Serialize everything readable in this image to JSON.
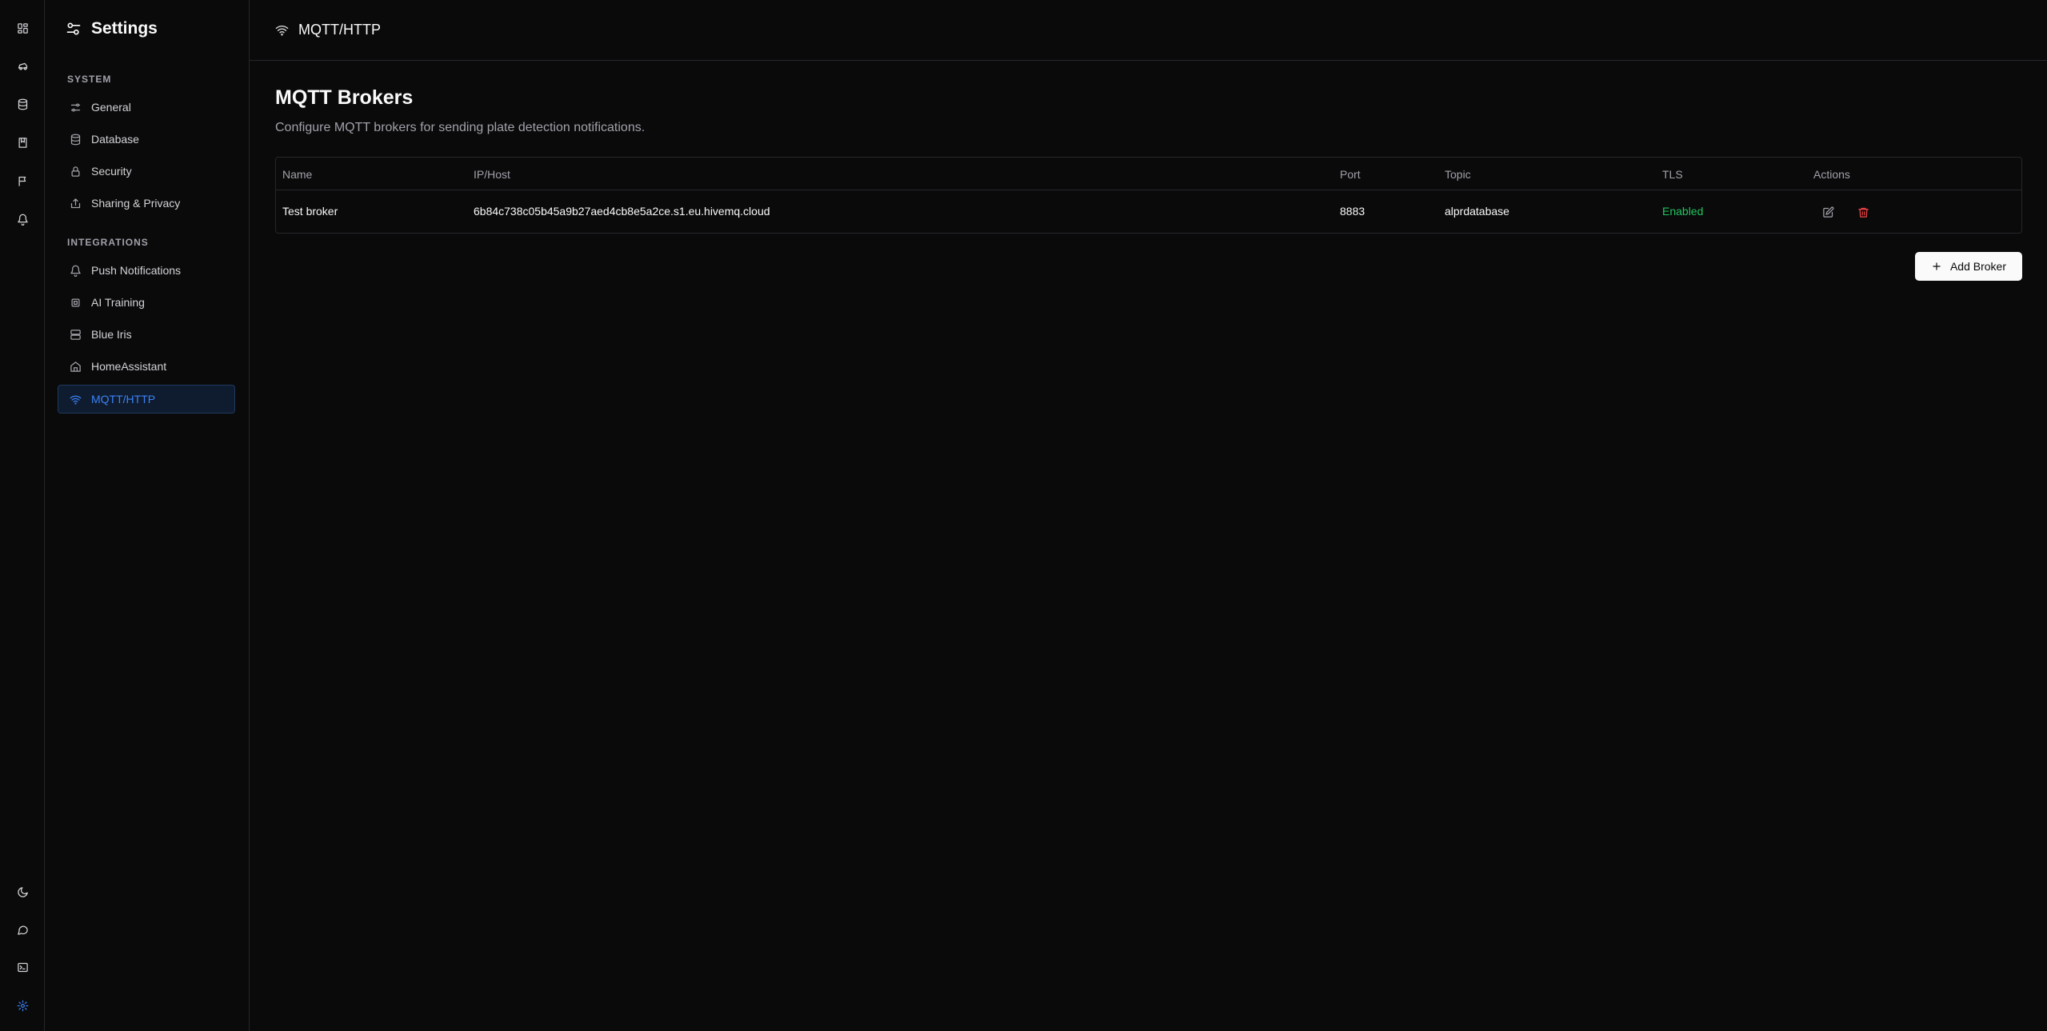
{
  "rail": {
    "top_icons": [
      "dashboard-icon",
      "car-icon",
      "database-icon",
      "book-icon",
      "flag-icon",
      "bell-icon"
    ],
    "bottom_icons": [
      "moon-icon",
      "message-icon",
      "terminal-icon",
      "gear-icon"
    ]
  },
  "sidebar": {
    "title": "Settings",
    "sections": [
      {
        "label": "SYSTEM",
        "items": [
          {
            "label": "General",
            "icon": "sliders-icon"
          },
          {
            "label": "Database",
            "icon": "database-icon"
          },
          {
            "label": "Security",
            "icon": "lock-icon"
          },
          {
            "label": "Sharing & Privacy",
            "icon": "share-icon"
          }
        ]
      },
      {
        "label": "INTEGRATIONS",
        "items": [
          {
            "label": "Push Notifications",
            "icon": "bell-icon"
          },
          {
            "label": "AI Training",
            "icon": "cpu-icon"
          },
          {
            "label": "Blue Iris",
            "icon": "server-icon"
          },
          {
            "label": "HomeAssistant",
            "icon": "home-icon"
          },
          {
            "label": "MQTT/HTTP",
            "icon": "wifi-icon",
            "active": true
          }
        ]
      }
    ]
  },
  "header": {
    "title": "MQTT/HTTP",
    "icon": "wifi-icon"
  },
  "main": {
    "title": "MQTT Brokers",
    "description": "Configure MQTT brokers for sending plate detection notifications.",
    "table": {
      "columns": [
        "Name",
        "IP/Host",
        "Port",
        "Topic",
        "TLS",
        "Actions"
      ],
      "rows": [
        {
          "name": "Test broker",
          "host": "6b84c738c05b45a9b27aed4cb8e5a2ce.s1.eu.hivemq.cloud",
          "port": "8883",
          "topic": "alprdatabase",
          "tls": "Enabled"
        }
      ]
    },
    "add_button": "Add Broker"
  },
  "colors": {
    "accent": "#3b82f6",
    "success": "#22c55e",
    "danger": "#ef4444",
    "background": "#0a0a0b",
    "border": "#27272a"
  }
}
